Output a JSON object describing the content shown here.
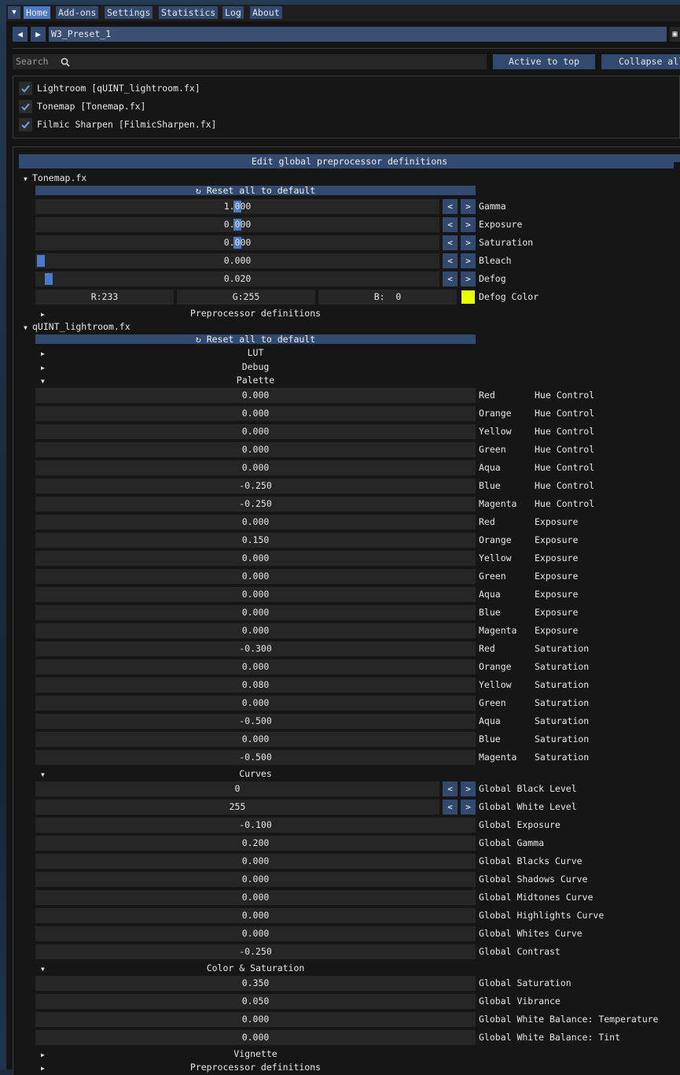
{
  "menu": {
    "items": [
      "Home",
      "Add-ons",
      "Settings",
      "Statistics",
      "Log",
      "About"
    ]
  },
  "preset": {
    "name": "W3_Preset_1"
  },
  "search": {
    "placeholder": "Search",
    "active_to_top": "Active to top",
    "collapse_all": "Collapse all"
  },
  "effects": [
    "Lightroom [qUINT_lightroom.fx]",
    "Tonemap [Tonemap.fx]",
    "Filmic Sharpen [FilmicSharpen.fx]"
  ],
  "global_header": "Edit global preprocessor definitions",
  "tonemap": {
    "title": "Tonemap.fx",
    "reset": "Reset all to default",
    "params": [
      {
        "value": "1.000",
        "label": "Gamma",
        "fill": 0.5
      },
      {
        "value": "0.000",
        "label": "Exposure",
        "fill": 0.5
      },
      {
        "value": "0.000",
        "label": "Saturation",
        "fill": 0.5
      },
      {
        "value": "0.000",
        "label": "Bleach",
        "fill": 0.0
      },
      {
        "value": "0.020",
        "label": "Defog",
        "fill": 0.02
      }
    ],
    "defog_color": {
      "r": "R:233",
      "g": "G:255",
      "b": "B:  0",
      "label": "Defog Color",
      "swatch": "#e9ff00"
    },
    "preproc": "Preprocessor definitions"
  },
  "lightroom": {
    "title": "qUINT_lightroom.fx",
    "reset": "Reset all to default",
    "sections": {
      "lut": "LUT",
      "debug": "Debug",
      "palette": "Palette",
      "curves": "Curves",
      "color_sat": "Color & Saturation",
      "vignette": "Vignette",
      "preproc": "Preprocessor definitions"
    },
    "palette": [
      {
        "value": "0.000",
        "a": "Red",
        "b": "Hue Control"
      },
      {
        "value": "0.000",
        "a": "Orange",
        "b": "Hue Control"
      },
      {
        "value": "0.000",
        "a": "Yellow",
        "b": "Hue Control"
      },
      {
        "value": "0.000",
        "a": "Green",
        "b": "Hue Control"
      },
      {
        "value": "0.000",
        "a": "Aqua",
        "b": "Hue Control"
      },
      {
        "value": "-0.250",
        "a": "Blue",
        "b": "Hue Control"
      },
      {
        "value": "-0.250",
        "a": "Magenta",
        "b": "Hue Control"
      },
      {
        "value": "0.000",
        "a": "Red",
        "b": "Exposure"
      },
      {
        "value": "0.150",
        "a": "Orange",
        "b": "Exposure"
      },
      {
        "value": "0.000",
        "a": "Yellow",
        "b": "Exposure"
      },
      {
        "value": "0.000",
        "a": "Green",
        "b": "Exposure"
      },
      {
        "value": "0.000",
        "a": "Aqua",
        "b": "Exposure"
      },
      {
        "value": "0.000",
        "a": "Blue",
        "b": "Exposure"
      },
      {
        "value": "0.000",
        "a": "Magenta",
        "b": "Exposure"
      },
      {
        "value": "-0.300",
        "a": "Red",
        "b": "Saturation"
      },
      {
        "value": "0.000",
        "a": "Orange",
        "b": "Saturation"
      },
      {
        "value": "0.080",
        "a": "Yellow",
        "b": "Saturation"
      },
      {
        "value": "0.000",
        "a": "Green",
        "b": "Saturation"
      },
      {
        "value": "-0.500",
        "a": "Aqua",
        "b": "Saturation"
      },
      {
        "value": "0.000",
        "a": "Blue",
        "b": "Saturation"
      },
      {
        "value": "-0.500",
        "a": "Magenta",
        "b": "Saturation"
      }
    ],
    "curves_int": [
      {
        "value": "0",
        "label": "Global Black Level"
      },
      {
        "value": "255",
        "label": "Global White Level"
      }
    ],
    "curves": [
      {
        "value": "-0.100",
        "label": "Global Exposure"
      },
      {
        "value": "0.200",
        "label": "Global Gamma"
      },
      {
        "value": "0.000",
        "label": "Global Blacks Curve"
      },
      {
        "value": "0.000",
        "label": "Global Shadows Curve"
      },
      {
        "value": "0.000",
        "label": "Global Midtones Curve"
      },
      {
        "value": "0.000",
        "label": "Global Highlights Curve"
      },
      {
        "value": "0.000",
        "label": "Global Whites Curve"
      },
      {
        "value": "-0.250",
        "label": "Global Contrast"
      }
    ],
    "color_sat": [
      {
        "value": "0.350",
        "label": "Global Saturation"
      },
      {
        "value": "0.050",
        "label": "Global Vibrance"
      },
      {
        "value": "0.000",
        "label": "Global White Balance: Temperature"
      },
      {
        "value": "0.000",
        "label": "Global White Balance: Tint"
      }
    ]
  },
  "colors": {
    "accent": "#4a7ac8",
    "button": "#324a70",
    "frame": "#262626",
    "window": "#141414"
  }
}
